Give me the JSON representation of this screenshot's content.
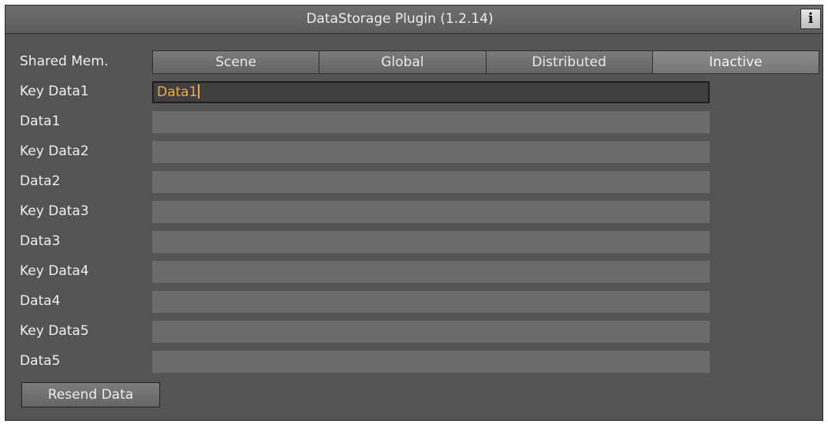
{
  "window": {
    "title": "DataStorage Plugin (1.2.14)",
    "info_label": "i"
  },
  "shared_mem": {
    "label": "Shared Mem.",
    "options": [
      "Scene",
      "Global",
      "Distributed",
      "Inactive"
    ],
    "selected": "Inactive"
  },
  "fields": [
    {
      "label": "Key Data1",
      "value": "Data1",
      "active": true
    },
    {
      "label": "Data1",
      "value": ""
    },
    {
      "label": "Key Data2",
      "value": ""
    },
    {
      "label": "Data2",
      "value": ""
    },
    {
      "label": "Key Data3",
      "value": ""
    },
    {
      "label": "Data3",
      "value": ""
    },
    {
      "label": "Key Data4",
      "value": ""
    },
    {
      "label": "Data4",
      "value": ""
    },
    {
      "label": "Key Data5",
      "value": ""
    },
    {
      "label": "Data5",
      "value": ""
    }
  ],
  "actions": {
    "resend_label": "Resend Data"
  },
  "colors": {
    "panel_bg": "#545454",
    "field_bg": "#6b6b6b",
    "active_text": "#f0a93a"
  }
}
